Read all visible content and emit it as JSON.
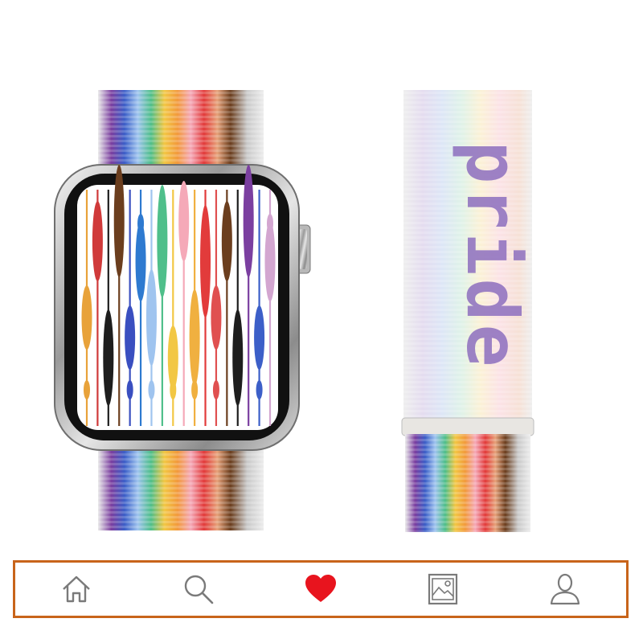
{
  "colors": {
    "tabbar_border": "#c8641a",
    "icon_stroke": "#7a7a7a",
    "heart_active": "#e8141e",
    "rainbow": [
      "#7b3fa0",
      "#3c5fc8",
      "#9fc4ef",
      "#4fbf8a",
      "#f2c744",
      "#f29a3c",
      "#f5a9b8",
      "#e23b3b",
      "#6b3e1e",
      "#1e1e1e",
      "#ffffff"
    ]
  },
  "product": {
    "image_label": "pride-watch-and-sport-loop-band",
    "band_text": "pride"
  },
  "tabs": [
    {
      "id": "home",
      "icon": "home-icon",
      "active": false
    },
    {
      "id": "search",
      "icon": "search-icon",
      "active": false
    },
    {
      "id": "favorites",
      "icon": "heart-icon",
      "active": true
    },
    {
      "id": "gallery",
      "icon": "image-icon",
      "active": false
    },
    {
      "id": "profile",
      "icon": "user-icon",
      "active": false
    }
  ]
}
